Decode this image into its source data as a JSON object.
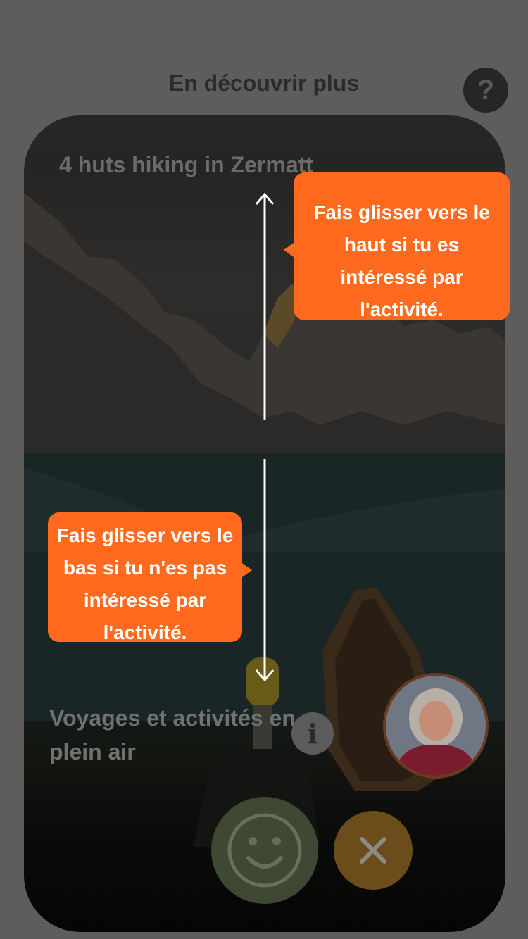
{
  "header": {
    "title": "En découvrir plus",
    "help_label": "?"
  },
  "card": {
    "title": "4 huts hiking in Zermatt",
    "category": "Voyages et activités en plein air",
    "info_label": "i"
  },
  "hints": {
    "swipe_up": "Fais glisser vers le haut si tu es intéressé par l'activité.",
    "swipe_down": "Fais glisser vers le bas si tu n'es pas intéressé par l'activité."
  },
  "actions": {
    "like_icon": "smiley-icon",
    "dislike_icon": "close-icon"
  },
  "colors": {
    "accent": "#ff6a1f",
    "like": "#3f4833",
    "dislike": "#6b4d1b",
    "overlay": "#5e5d5b"
  }
}
